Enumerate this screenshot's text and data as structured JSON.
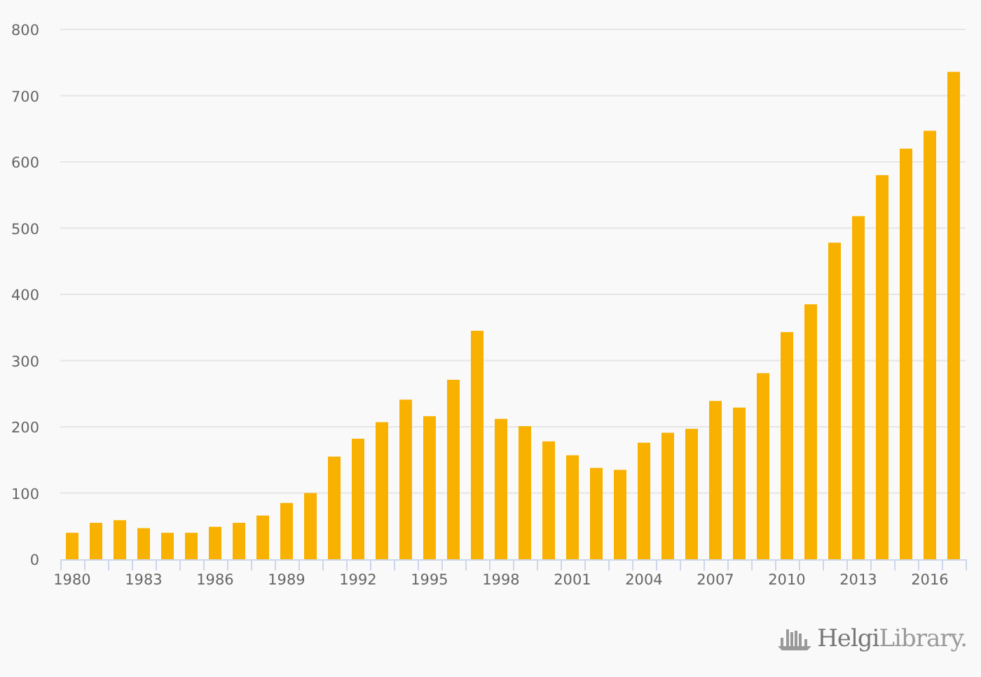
{
  "chart": {
    "chart_data": {
      "type": "bar",
      "x": [
        1980,
        1981,
        1982,
        1983,
        1984,
        1985,
        1986,
        1987,
        1988,
        1989,
        1990,
        1991,
        1992,
        1993,
        1994,
        1995,
        1996,
        1997,
        1998,
        1999,
        2000,
        2001,
        2002,
        2003,
        2004,
        2005,
        2006,
        2007,
        2008,
        2009,
        2010,
        2011,
        2012,
        2013,
        2014,
        2015,
        2016,
        2017
      ],
      "series": [
        {
          "color": "#f9b100",
          "values": [
            40,
            55,
            59,
            47,
            40,
            40,
            49,
            55,
            66,
            85,
            100,
            155,
            182,
            207,
            241,
            216,
            271,
            345,
            212,
            201,
            178,
            157,
            138,
            135,
            176,
            191,
            197,
            239,
            229,
            281,
            343,
            385,
            478,
            518,
            580,
            620,
            647,
            736
          ]
        }
      ],
      "xlim": [
        1979.5,
        2017.5
      ],
      "ylim": [
        0,
        800
      ],
      "yticks": [
        0,
        100,
        200,
        300,
        400,
        500,
        600,
        700,
        800
      ],
      "xticks": [
        1980,
        1983,
        1986,
        1989,
        1992,
        1995,
        1998,
        2001,
        2004,
        2007,
        2010,
        2013,
        2016
      ],
      "grid": true
    }
  },
  "logo": {
    "text": "**Helgi**Library."
  }
}
